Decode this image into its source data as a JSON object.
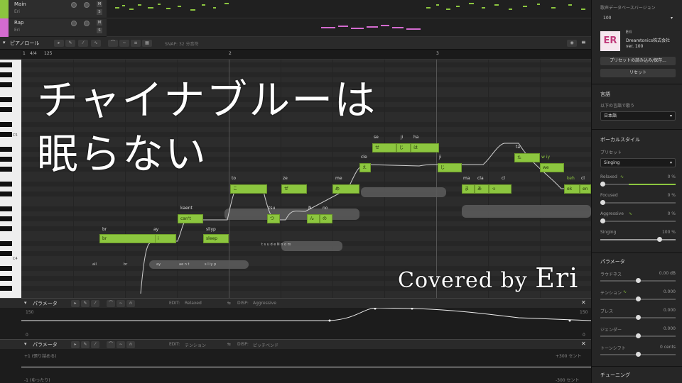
{
  "tracks": [
    {
      "name": "Main",
      "singer": "Eri",
      "color": "#8cc63f"
    },
    {
      "name": "Rap",
      "singer": "Eri",
      "color": "#d46bd0"
    }
  ],
  "track_btn": {
    "m": "M",
    "s": "S"
  },
  "pianoroll": {
    "label": "ピアノロール",
    "snap": "SNAP: 32 分音符",
    "tempo": "125",
    "timesig": "4/4",
    "bars": [
      "1",
      "2",
      "3"
    ],
    "c5": "C5",
    "c4": "C4"
  },
  "title": {
    "line1": "チャイナブルーは",
    "line2": "眠らない",
    "credit_prefix": "Covered by",
    "credit_name": "Eri"
  },
  "notes": [
    {
      "text": "br",
      "lyric": "br"
    },
    {
      "text": "i",
      "lyric": "ay"
    },
    {
      "text": "can't",
      "lyric": "kaent"
    },
    {
      "text": "sleep",
      "lyric": "sliyp"
    },
    {
      "text": "こ",
      "lyric": "to"
    },
    {
      "text": "つ",
      "lyric": "tsu"
    },
    {
      "text": "ぜ",
      "lyric": "ze"
    },
    {
      "text": "ん",
      "lyric": "N"
    },
    {
      "text": "の",
      "lyric": "no"
    },
    {
      "text": "め",
      "lyric": "me"
    },
    {
      "text": "え",
      "lyric": "cle"
    },
    {
      "text": "せ",
      "lyric": "se"
    },
    {
      "text": "じ",
      "lyric": "ji"
    },
    {
      "text": "は",
      "lyric": "ha"
    },
    {
      "text": "じ",
      "lyric": "ji"
    },
    {
      "text": "ま",
      "lyric": "ma"
    },
    {
      "text": "あ",
      "lyric": "cla"
    },
    {
      "text": "っ",
      "lyric": "cl"
    },
    {
      "text": "た",
      "lyric": "ta"
    },
    {
      "text": "w",
      "lyric": "w iy"
    },
    {
      "text": "we",
      "lyric": ""
    },
    {
      "text": "ek",
      "lyric": "keh"
    },
    {
      "text": "en",
      "lyric": "cl"
    }
  ],
  "phonemes": {
    "all": "all",
    "br": "br",
    "ay": "ay",
    "ae": "ae n t",
    "sl": "s l iy p",
    "tsu": "ts u",
    "th": "t s u d e N n o m"
  },
  "param1": {
    "label": "パラメータ",
    "edit": "EDIT:",
    "edit_val": "Relaxed",
    "disp": "DISP:",
    "disp_val": "Aggressive",
    "max": "150",
    "min": "0",
    "rmax": "150",
    "rmin": "0"
  },
  "param2": {
    "label": "パラメータ",
    "edit": "EDIT:",
    "edit_val": "テンション",
    "disp": "DISP:",
    "disp_val": "ピッチベンド",
    "top": "+1 (張り詰める)",
    "bottom": "-1 (ゆったり)",
    "rtop": "+300 セント",
    "rbottom": "-300 セント"
  },
  "right": {
    "db_version_label": "歌声データベースバージョン",
    "db_version": "100",
    "singer_name": "Eri",
    "company": "Dreamtonics株式会社",
    "ver": "ver. 100",
    "logo": "ER",
    "preset_btn": "プリセットの読み込み/保存...",
    "reset_btn": "リセット",
    "lang_h": "言語",
    "lang_s": "以下の言語で歌う",
    "lang_val": "日本語",
    "vstyle_h": "ボーカルスタイル",
    "preset_l": "プリセット",
    "preset_val": "Singing",
    "styles": [
      {
        "name": "Relaxed",
        "val": "0 %",
        "pos": 0
      },
      {
        "name": "Focused",
        "val": "0 %",
        "pos": 0
      },
      {
        "name": "Aggressive",
        "val": "0 %",
        "pos": 0
      },
      {
        "name": "Singing",
        "val": "100 %",
        "pos": 1
      }
    ],
    "param_h": "パラメータ",
    "params": [
      {
        "name": "ラウドネス",
        "val": "0.00 dB",
        "pos": 0.5
      },
      {
        "name": "テンション",
        "val": "0.000",
        "pos": 0.5
      },
      {
        "name": "ブレス",
        "val": "0.000",
        "pos": 0.5
      },
      {
        "name": "ジェンダー",
        "val": "0.000",
        "pos": 0.5
      },
      {
        "name": "トーンシフト",
        "val": "0 cents",
        "pos": 0.5
      }
    ],
    "tuning_h": "チューニング"
  }
}
